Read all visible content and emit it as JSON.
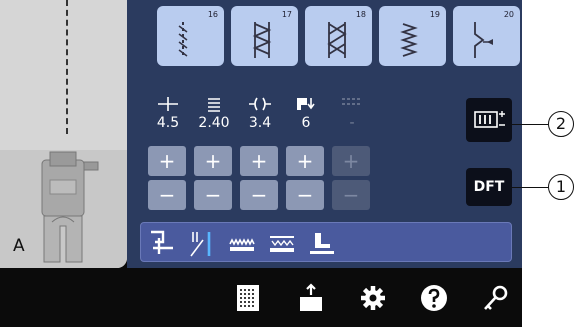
{
  "preview": {
    "presser_foot_letter": "A",
    "needle_icon": "needle-position-line"
  },
  "patterns": [
    {
      "number": "16",
      "icon": "straight-stitch-icon"
    },
    {
      "number": "17",
      "icon": "zigzag-stitch-icon"
    },
    {
      "number": "18",
      "icon": "triangle-stitch-icon"
    },
    {
      "number": "19",
      "icon": "multi-zigzag-stitch-icon"
    },
    {
      "number": "20",
      "icon": "blind-hem-stitch-icon"
    }
  ],
  "params": [
    {
      "icon": "stitch-width-icon",
      "value": "4.5"
    },
    {
      "icon": "stitch-length-icon",
      "value": "2.40"
    },
    {
      "icon": "tension-icon",
      "value": "3.4"
    },
    {
      "icon": "foot-pressure-icon",
      "value": "6"
    },
    {
      "icon": "feed-icon",
      "value": "-"
    }
  ],
  "steppers": {
    "plus": "+",
    "minus": "−"
  },
  "side_buttons": {
    "option_icon": "stitch-option-icon",
    "dft_label": "DFT"
  },
  "toolbar": [
    "needle-up-down-icon",
    "twin-needle-icon",
    "feed-dog-icon",
    "dual-feed-icon",
    "presser-foot-icon"
  ],
  "bottom_bar": [
    "memory-icon",
    "export-icon",
    "settings-gear-icon",
    "help-icon",
    "key-icon"
  ],
  "callouts": {
    "first": "1",
    "second": "2"
  },
  "colors": {
    "panel": "#2b3b5f",
    "pattern_bg": "#b9ccef",
    "stepper": "#8c98b4",
    "toolbar": "#4a5a9e"
  }
}
